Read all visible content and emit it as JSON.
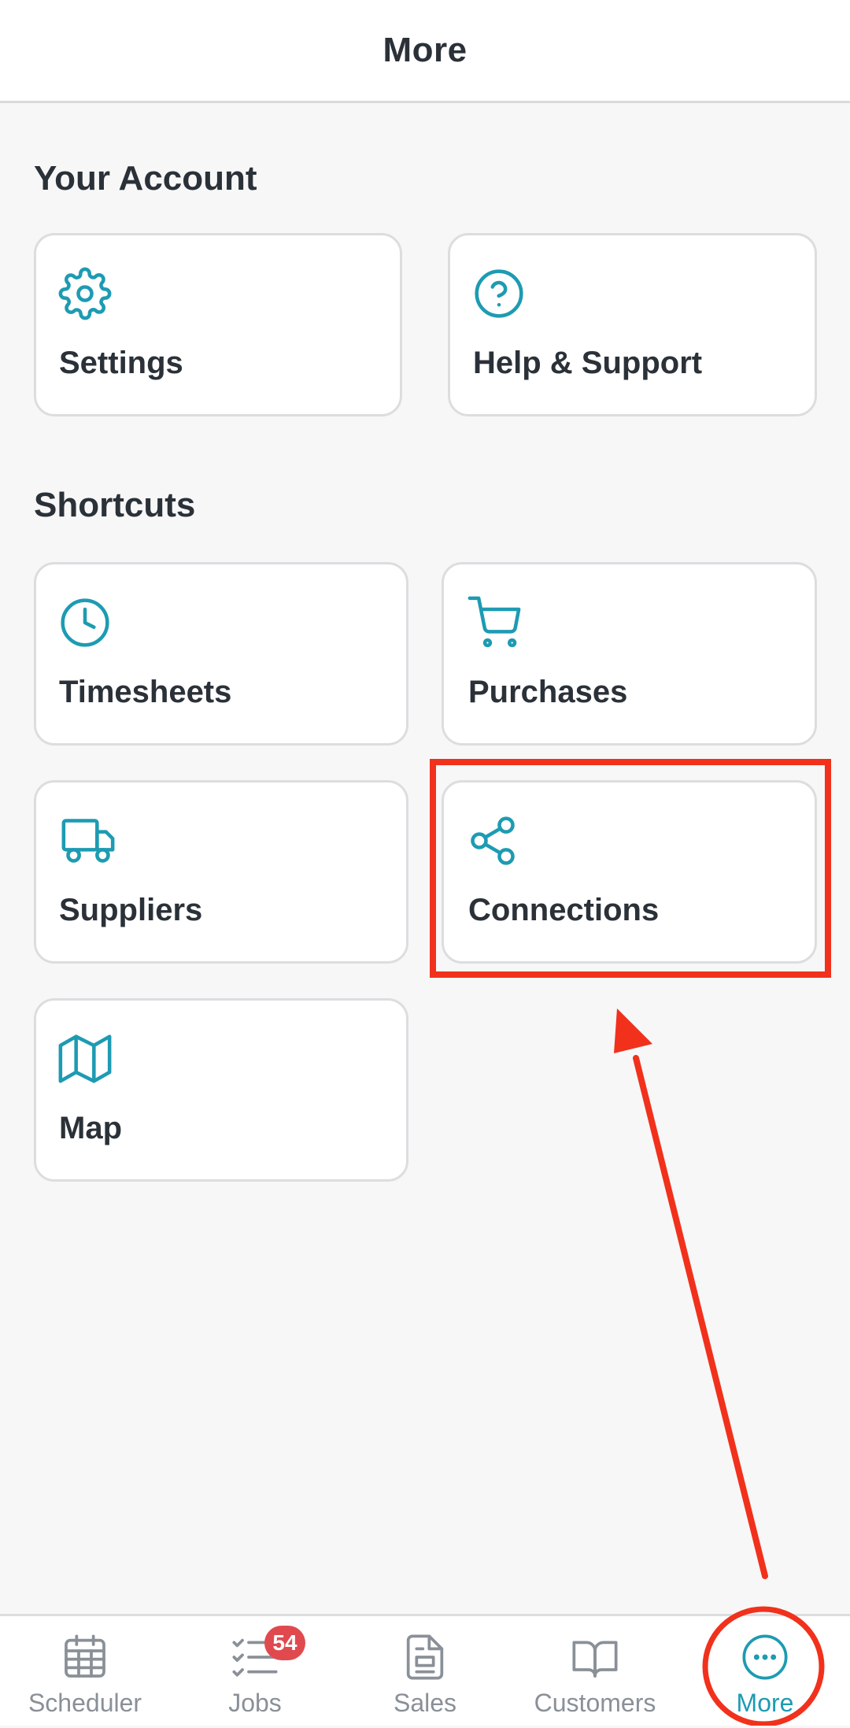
{
  "header": {
    "title": "More"
  },
  "sections": {
    "account": {
      "title": "Your Account",
      "items": [
        {
          "label": "Settings",
          "icon": "gear-icon"
        },
        {
          "label": "Help & Support",
          "icon": "question-circle-icon"
        }
      ]
    },
    "shortcuts": {
      "title": "Shortcuts",
      "items": [
        {
          "label": "Timesheets",
          "icon": "clock-icon"
        },
        {
          "label": "Purchases",
          "icon": "shopping-cart-icon"
        },
        {
          "label": "Suppliers",
          "icon": "truck-icon"
        },
        {
          "label": "Connections",
          "icon": "share-icon"
        },
        {
          "label": "Map",
          "icon": "map-icon"
        }
      ]
    }
  },
  "tabbar": {
    "tabs": [
      {
        "label": "Scheduler",
        "icon": "calendar-icon"
      },
      {
        "label": "Jobs",
        "icon": "checklist-icon",
        "badge": "54"
      },
      {
        "label": "Sales",
        "icon": "document-icon"
      },
      {
        "label": "Customers",
        "icon": "book-icon"
      },
      {
        "label": "More",
        "icon": "more-dots-icon",
        "active": true
      }
    ]
  },
  "colors": {
    "accent": "#1d9bb2",
    "text": "#2b3138",
    "inactive_tab": "#8a9097",
    "badge": "#e04a4f",
    "annotation": "#f1311c",
    "background": "#f7f7f7",
    "card": "#ffffff"
  }
}
